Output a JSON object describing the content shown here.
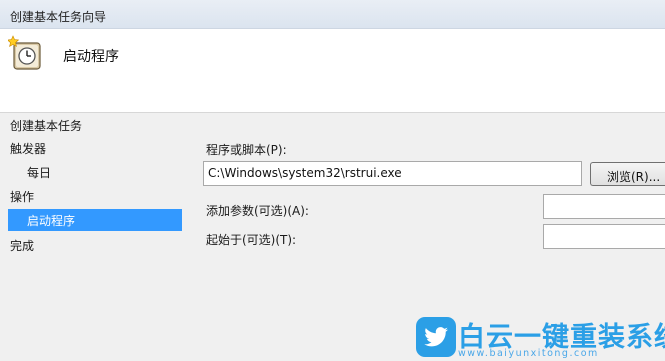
{
  "window": {
    "title": "创建基本任务向导"
  },
  "header": {
    "icon": "task-scheduler-clock-icon",
    "title": "启动程序"
  },
  "nav": {
    "heading": "创建基本任务",
    "items": [
      {
        "label": "触发器",
        "level": 0,
        "selected": false
      },
      {
        "label": "每日",
        "level": 1,
        "selected": false
      },
      {
        "label": "操作",
        "level": 0,
        "selected": false
      },
      {
        "label": "启动程序",
        "level": 1,
        "selected": true
      },
      {
        "label": "完成",
        "level": 0,
        "selected": false
      }
    ]
  },
  "form": {
    "program_label": "程序或脚本(P):",
    "program_value": "C:\\Windows\\system32\\rstrui.exe",
    "browse_label": "浏览(R)...",
    "args_label": "添加参数(可选)(A):",
    "args_value": "",
    "startin_label": "起始于(可选)(T):",
    "startin_value": ""
  },
  "watermark": {
    "icon": "twitter-bird-icon",
    "brand": "白云一键重装系统",
    "url": "www.baiyunxitong.com",
    "color": "#2b9fe6"
  },
  "colors": {
    "selection": "#3399ff",
    "panel": "#f0f0f0"
  }
}
